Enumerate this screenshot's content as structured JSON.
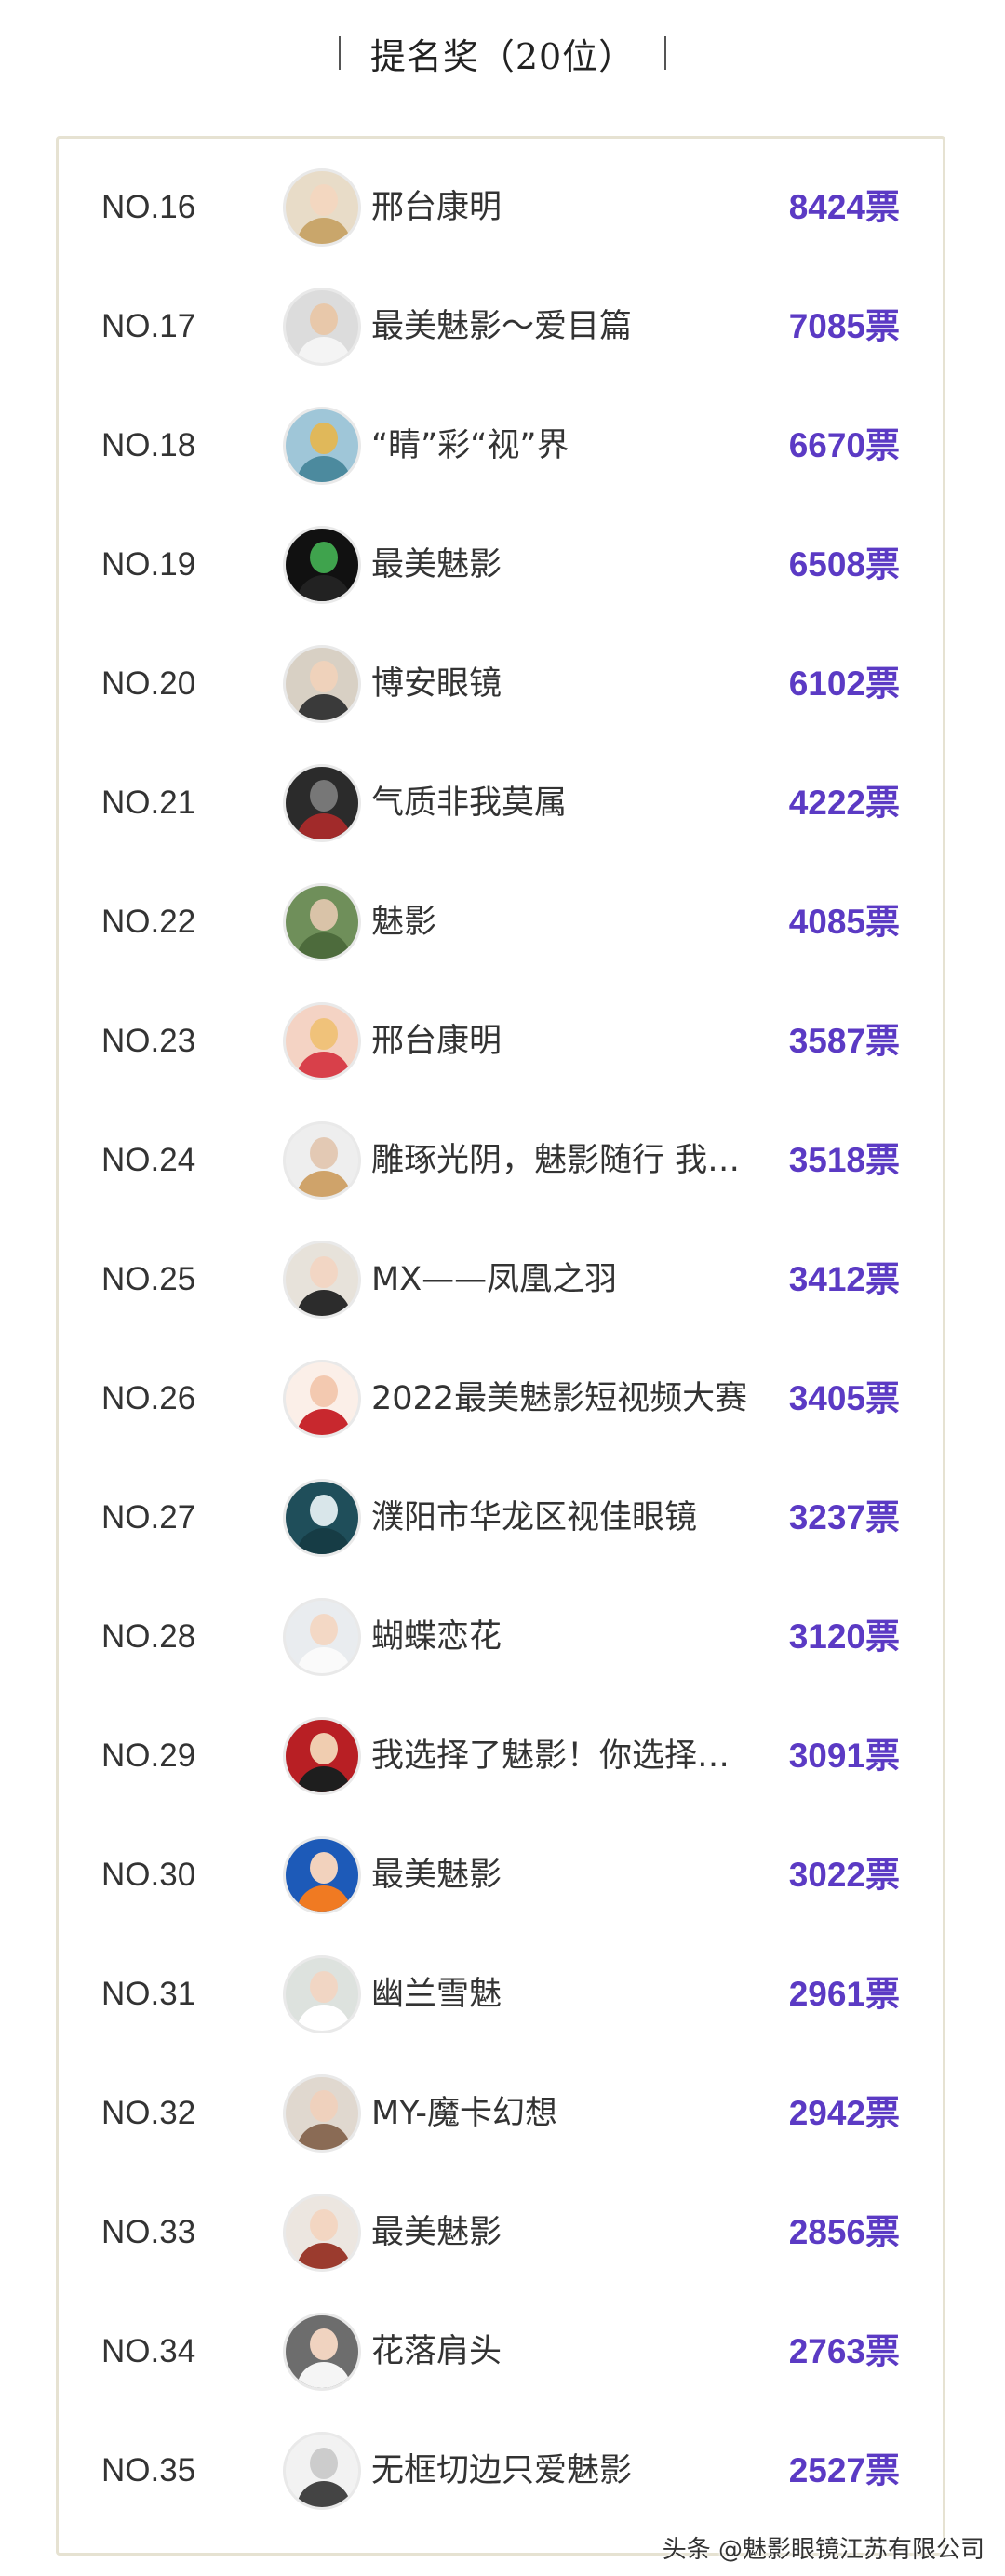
{
  "header": {
    "title": "提名奖（20位）"
  },
  "list": {
    "vote_suffix": "票",
    "rows": [
      {
        "rank": "NO.16",
        "name": "邢台康明",
        "votes": "8424",
        "avatar_bg": "#e8dcc8",
        "avatar_face": "#f3d7c0",
        "avatar_body": "#c9a66b"
      },
      {
        "rank": "NO.17",
        "name": "最美魅影～爱目篇",
        "votes": "7085",
        "avatar_bg": "#dcdcdc",
        "avatar_face": "#e8c8aa",
        "avatar_body": "#f4f4f4"
      },
      {
        "rank": "NO.18",
        "name": "“睛”彩“视”界",
        "votes": "6670",
        "avatar_bg": "#9fc6d8",
        "avatar_face": "#e0b85a",
        "avatar_body": "#4c8a9e"
      },
      {
        "rank": "NO.19",
        "name": "最美魅影",
        "votes": "6508",
        "avatar_bg": "#111111",
        "avatar_face": "#3fa34d",
        "avatar_body": "#222222"
      },
      {
        "rank": "NO.20",
        "name": "博安眼镜",
        "votes": "6102",
        "avatar_bg": "#d8d0c4",
        "avatar_face": "#efd2bb",
        "avatar_body": "#3a3a3a"
      },
      {
        "rank": "NO.21",
        "name": "气质非我莫属",
        "votes": "4222",
        "avatar_bg": "#2b2b2b",
        "avatar_face": "#777777",
        "avatar_body": "#a12a2a"
      },
      {
        "rank": "NO.22",
        "name": "魅影",
        "votes": "4085",
        "avatar_bg": "#6f8f5a",
        "avatar_face": "#d9c3a8",
        "avatar_body": "#4d6b3c"
      },
      {
        "rank": "NO.23",
        "name": "邢台康明",
        "votes": "3587",
        "avatar_bg": "#f4d3c4",
        "avatar_face": "#f0c27a",
        "avatar_body": "#d8404a"
      },
      {
        "rank": "NO.24",
        "name": "雕琢光阴，魅影随行 我型我秀",
        "votes": "3518",
        "avatar_bg": "#eeeeee",
        "avatar_face": "#e3c9b4",
        "avatar_body": "#cfa36a"
      },
      {
        "rank": "NO.25",
        "name": "MX——凤凰之羽",
        "votes": "3412",
        "avatar_bg": "#e7e2da",
        "avatar_face": "#f2d6c4",
        "avatar_body": "#2c2c2c"
      },
      {
        "rank": "NO.26",
        "name": "2022最美魅影短视频大赛",
        "votes": "3405",
        "avatar_bg": "#fbefe8",
        "avatar_face": "#f3c9b0",
        "avatar_body": "#c8282e"
      },
      {
        "rank": "NO.27",
        "name": "濮阳市华龙区视佳眼镜",
        "votes": "3237",
        "avatar_bg": "#1f4e5a",
        "avatar_face": "#d9e6ea",
        "avatar_body": "#163c45"
      },
      {
        "rank": "NO.28",
        "name": "蝴蝶恋花",
        "votes": "3120",
        "avatar_bg": "#e9ecef",
        "avatar_face": "#f3d8c5",
        "avatar_body": "#fafafa"
      },
      {
        "rank": "NO.29",
        "name": "我选择了魅影！你选择了吗？",
        "votes": "3091",
        "avatar_bg": "#b81f24",
        "avatar_face": "#f0cdb0",
        "avatar_body": "#1e1e1e"
      },
      {
        "rank": "NO.30",
        "name": "最美魅影",
        "votes": "3022",
        "avatar_bg": "#1d5ab8",
        "avatar_face": "#f2d2bd",
        "avatar_body": "#f07a22"
      },
      {
        "rank": "NO.31",
        "name": "幽兰雪魅",
        "votes": "2961",
        "avatar_bg": "#dde2de",
        "avatar_face": "#f1d6c4",
        "avatar_body": "#ffffff"
      },
      {
        "rank": "NO.32",
        "name": "MY-魔卡幻想",
        "votes": "2942",
        "avatar_bg": "#e0d8cf",
        "avatar_face": "#efd1bd",
        "avatar_body": "#8a6b55"
      },
      {
        "rank": "NO.33",
        "name": "最美魅影",
        "votes": "2856",
        "avatar_bg": "#ece6e0",
        "avatar_face": "#f3d6c2",
        "avatar_body": "#9b3b2e"
      },
      {
        "rank": "NO.34",
        "name": "花落肩头",
        "votes": "2763",
        "avatar_bg": "#6d6d6d",
        "avatar_face": "#f0d3c0",
        "avatar_body": "#f5f5f5"
      },
      {
        "rank": "NO.35",
        "name": "无框切边只爱魅影",
        "votes": "2527",
        "avatar_bg": "#f2f2f2",
        "avatar_face": "#cccccc",
        "avatar_body": "#444444"
      }
    ]
  },
  "watermark": "头条 @魅影眼镜江苏有限公司"
}
